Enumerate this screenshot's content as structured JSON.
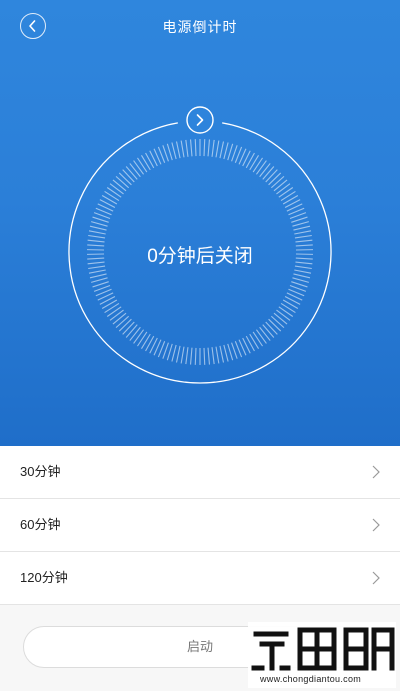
{
  "header": {
    "title": "电源倒计时",
    "back_icon": "chevron-left-icon"
  },
  "timer": {
    "status_text": "0分钟后关闭",
    "next_icon": "chevron-right-icon",
    "progress_fraction": 0
  },
  "options": [
    {
      "label": "30分钟",
      "icon": "chevron-right-icon"
    },
    {
      "label": "60分钟",
      "icon": "chevron-right-icon"
    },
    {
      "label": "120分钟",
      "icon": "chevron-right-icon"
    }
  ],
  "actions": {
    "start_label": "启动"
  },
  "watermark": {
    "url": "www.chongdiantou.com"
  },
  "colors": {
    "hero_top": "#2f86dd",
    "hero_bottom": "#1f6ec9",
    "text_light": "#ffffff",
    "list_text": "#222222"
  }
}
